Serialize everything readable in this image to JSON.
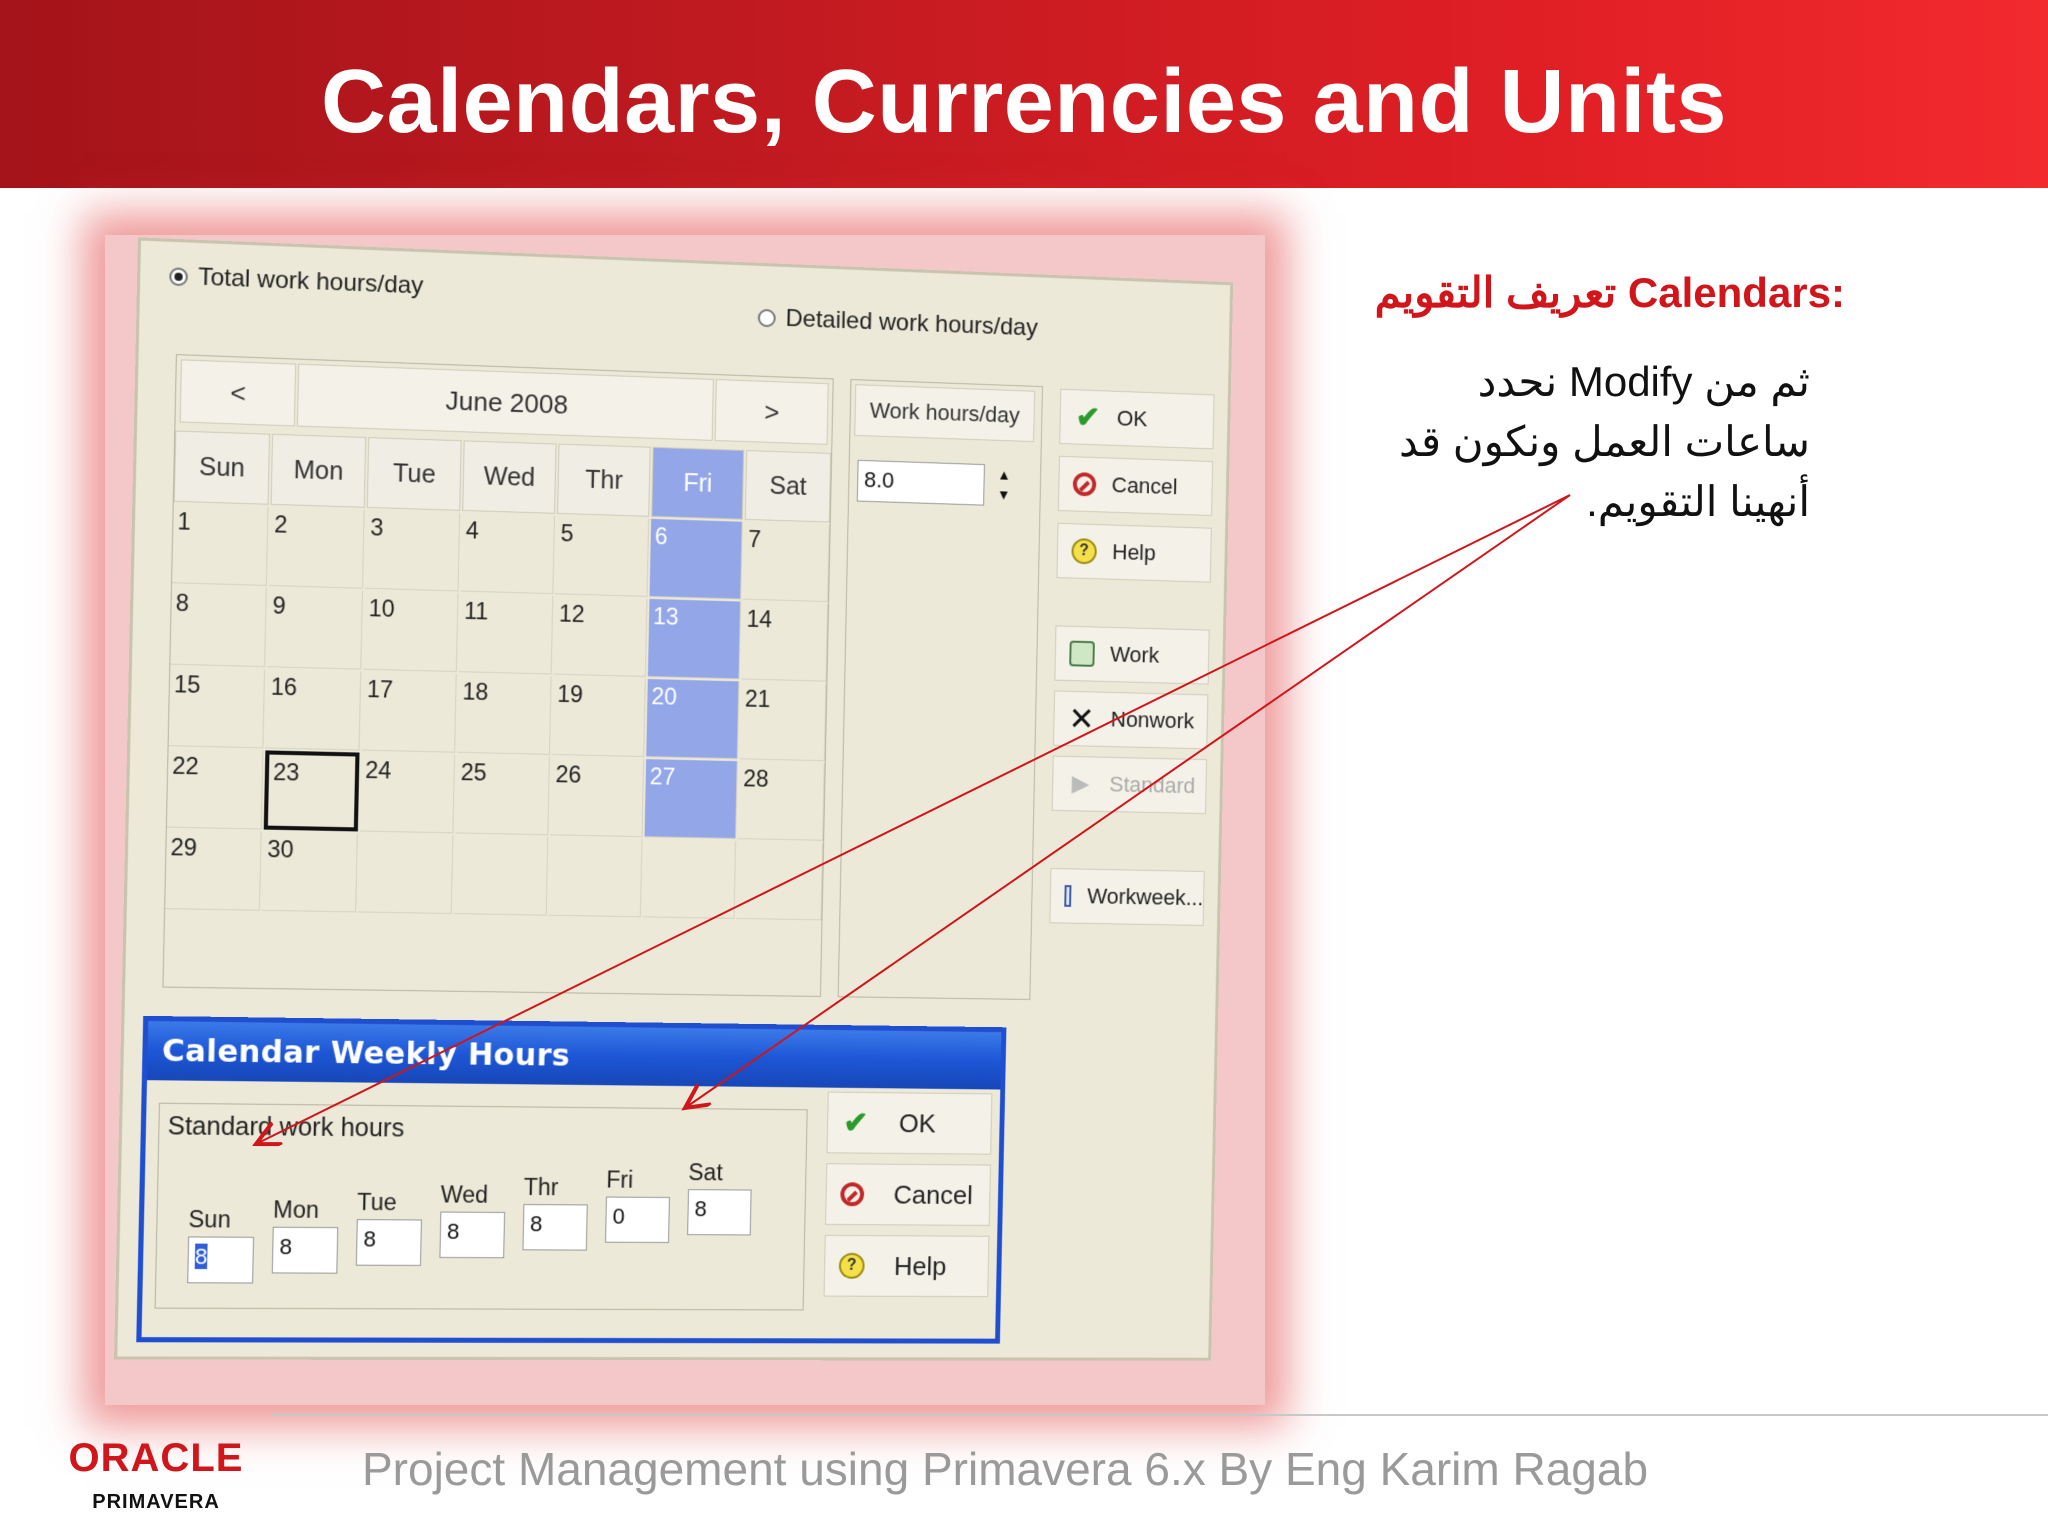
{
  "slide": {
    "title": "Calendars, Currencies and Units",
    "footer": "Project Management using Primavera 6.x By Eng Karim Ragab",
    "logo": {
      "brand": "ORACLE",
      "product": "PRIMAVERA",
      "brand_color": "#d0151b"
    },
    "banner_colors": [
      "#a4141a",
      "#f22a2e"
    ]
  },
  "dialog": {
    "radio_total": "Total work hours/day",
    "radio_detailed": "Detailed work hours/day",
    "calendar": {
      "prev": "<",
      "next": ">",
      "month": "June 2008",
      "weekdays": [
        "Sun",
        "Mon",
        "Tue",
        "Wed",
        "Thr",
        "Fri",
        "Sat"
      ],
      "highlight_color": "#93a6e8",
      "weeks": [
        [
          "1",
          "2",
          "3",
          "4",
          "5",
          "6",
          "7"
        ],
        [
          "8",
          "9",
          "10",
          "11",
          "12",
          "13",
          "14"
        ],
        [
          "15",
          "16",
          "17",
          "18",
          "19",
          "20",
          "21"
        ],
        [
          "22",
          "23",
          "24",
          "25",
          "26",
          "27",
          "28"
        ],
        [
          "29",
          "30",
          "",
          "",
          "",
          "",
          ""
        ]
      ]
    },
    "hours_label": "Work hours/day",
    "hours_value": "8.0",
    "buttons": {
      "ok": "OK",
      "cancel": "Cancel",
      "help": "Help",
      "work": "Work",
      "nonwork": "Nonwork",
      "standard": "Standard",
      "workweek": "Workweek..."
    }
  },
  "weekly": {
    "title": "Calendar Weekly Hours",
    "group_label": "Standard work hours",
    "days": [
      {
        "label": "Sun",
        "value": "8"
      },
      {
        "label": "Mon",
        "value": "8"
      },
      {
        "label": "Tue",
        "value": "8"
      },
      {
        "label": "Wed",
        "value": "8"
      },
      {
        "label": "Thr",
        "value": "8"
      },
      {
        "label": "Fri",
        "value": "0"
      },
      {
        "label": "Sat",
        "value": "8"
      }
    ],
    "buttons": {
      "ok": "OK",
      "cancel": "Cancel",
      "help": "Help"
    },
    "titlebar_color": "#1d56d6"
  },
  "note": {
    "heading": "تعريف التقويم Calendars:",
    "body": "ثم من Modify نحدد ساعات العمل ونكون قد أنهينا التقويم.",
    "arrow_color": "#d0151b"
  }
}
